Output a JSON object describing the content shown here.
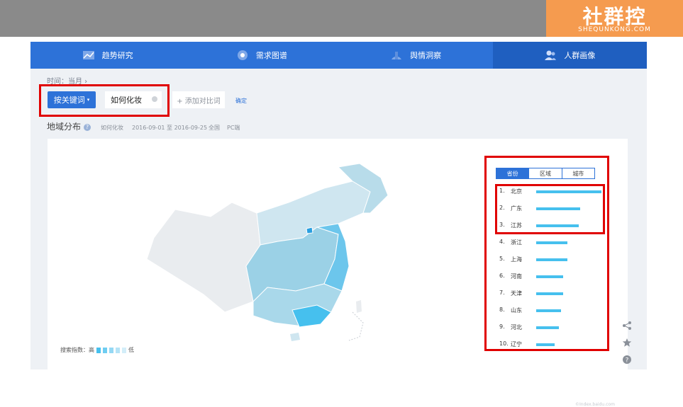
{
  "brand": {
    "name": "社群控",
    "sub": "SHEQUNKONG.COM"
  },
  "nav": {
    "items": [
      {
        "label": "趋势研究",
        "icon": "chart-icon"
      },
      {
        "label": "需求图谱",
        "icon": "bubble-icon"
      },
      {
        "label": "舆情洞察",
        "icon": "sentiment-icon"
      },
      {
        "label": "人群画像",
        "icon": "people-icon",
        "active": true
      }
    ]
  },
  "breadcrumb": "时间：当月 ›",
  "search": {
    "mode_button": "按关键词",
    "keyword": "如何化妆",
    "add_compare": "+ 添加对比词",
    "confirm": "确定"
  },
  "section": {
    "title": "地域分布",
    "help": "?",
    "meta_keyword": "如何化妆",
    "meta_range": "2016-09-01 至 2016-09-25",
    "meta_region": "全国",
    "meta_device": "PC端"
  },
  "legend": {
    "label": "搜索指数：高",
    "low": "低",
    "colors": [
      "#46c0ee",
      "#6fcdf1",
      "#95d8f4",
      "#b5e3f6",
      "#d3eef9"
    ]
  },
  "region_tabs": [
    {
      "label": "省份",
      "active": true
    },
    {
      "label": "区域"
    },
    {
      "label": "城市"
    }
  ],
  "ranking": [
    {
      "rank": "1.",
      "name": "北京",
      "value": 100
    },
    {
      "rank": "2.",
      "name": "广东",
      "value": 67
    },
    {
      "rank": "3.",
      "name": "江苏",
      "value": 65
    },
    {
      "rank": "4.",
      "name": "浙江",
      "value": 48
    },
    {
      "rank": "5.",
      "name": "上海",
      "value": 48
    },
    {
      "rank": "6.",
      "name": "河南",
      "value": 41
    },
    {
      "rank": "7.",
      "name": "天津",
      "value": 41
    },
    {
      "rank": "8.",
      "name": "山东",
      "value": 38
    },
    {
      "rank": "9.",
      "name": "河北",
      "value": 35
    },
    {
      "rank": "10.",
      "name": "辽宁",
      "value": 28
    }
  ],
  "watermark": "©Index.baidu.com",
  "tools": [
    "share-icon",
    "star-icon",
    "help-icon"
  ],
  "colors": {
    "nav": "#2d72d8",
    "accent": "#46c0ee",
    "highlight": "#e00000",
    "brand": "#f59b4f"
  }
}
